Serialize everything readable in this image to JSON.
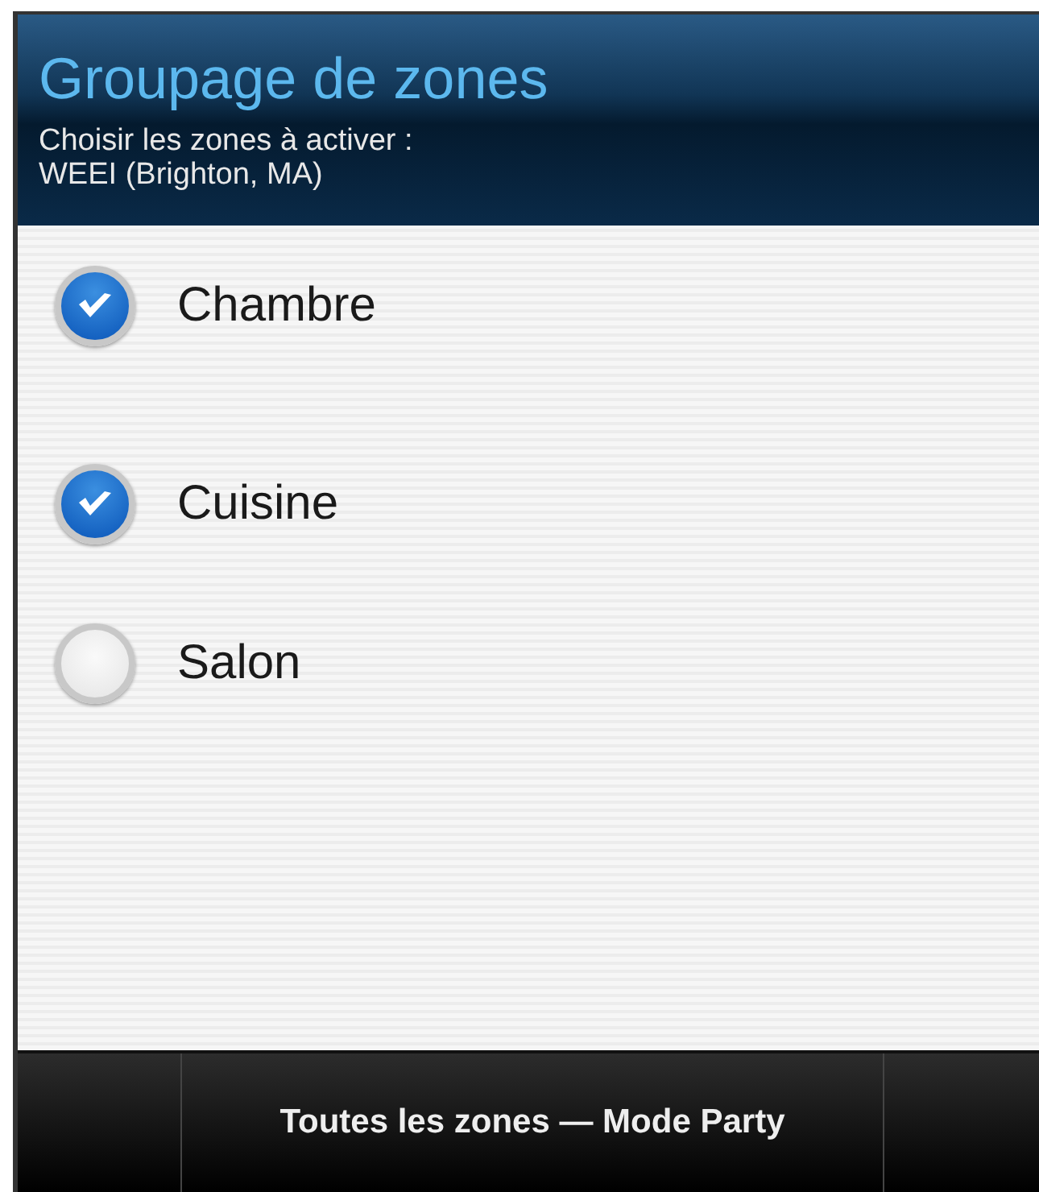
{
  "header": {
    "title": "Groupage de zones",
    "subtitle": "Choisir les zones à activer :",
    "source": "WEEI (Brighton, MA)"
  },
  "zones": [
    {
      "label": "Chambre",
      "checked": true
    },
    {
      "label": "Cuisine",
      "checked": true
    },
    {
      "label": "Salon",
      "checked": false
    }
  ],
  "bottom_bar": {
    "button": "Toutes les zones — Mode Party"
  }
}
